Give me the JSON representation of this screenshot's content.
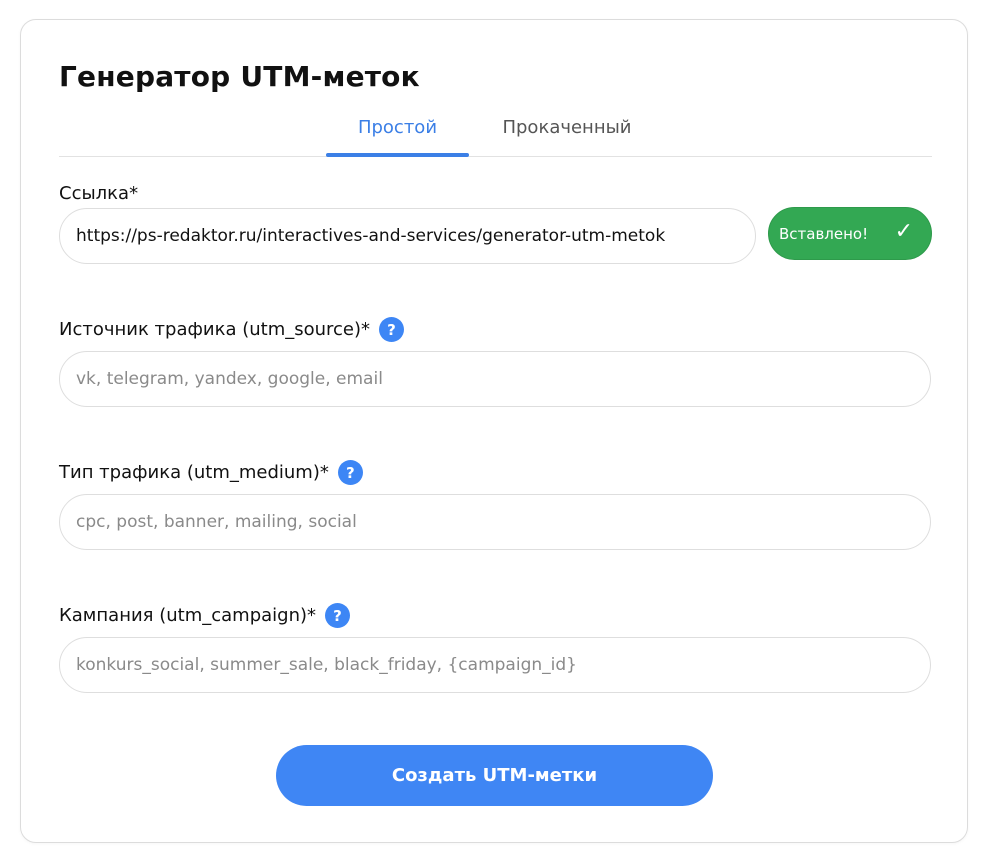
{
  "form": {
    "title": "Генератор UTM-меток",
    "tabs": [
      {
        "label": "Простой",
        "active": true
      },
      {
        "label": "Прокаченный",
        "active": false
      }
    ]
  },
  "fields": {
    "url": {
      "label": "Ссылка*",
      "value": "https://ps-redaktor.ru/interactives-and-services/generator-utm-metok"
    },
    "source": {
      "label": "Источник трафика (utm_source)*",
      "placeholder": "vk, telegram, yandex, google, email",
      "help": "?"
    },
    "medium": {
      "label": "Тип трафика (utm_medium)*",
      "placeholder": "cpc, post, banner, mailing, social",
      "help": "?"
    },
    "campaign": {
      "label": "Кампания (utm_campaign)*",
      "placeholder": "konkurs_social, summer_sale, black_friday, {campaign_id}",
      "help": "?"
    }
  },
  "paste_button": {
    "label": "Вставлено!",
    "icon": "check-icon",
    "glyph": "✓",
    "color": "#33a853"
  },
  "submit_button": {
    "label": "Создать UTM-метки",
    "color": "#3f86f4"
  },
  "colors": {
    "accent": "#3b7fe6",
    "help": "#3d86f5"
  }
}
